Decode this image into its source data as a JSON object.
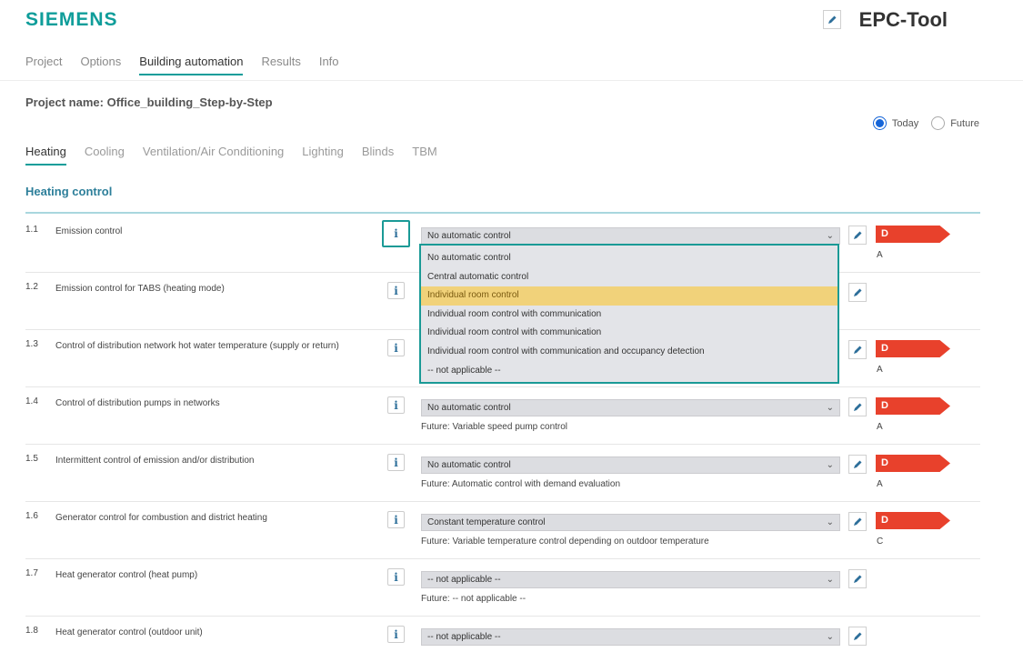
{
  "brand": {
    "logo": "SIEMENS",
    "app_title": "EPC-Tool"
  },
  "main_tabs": [
    {
      "label": "Project"
    },
    {
      "label": "Options"
    },
    {
      "label": "Building automation"
    },
    {
      "label": "Results"
    },
    {
      "label": "Info"
    }
  ],
  "project_name": "Project name: Office_building_Step-by-Step",
  "scenario": {
    "today": "Today",
    "future": "Future",
    "selected": "Today"
  },
  "sub_tabs": [
    {
      "label": "Heating"
    },
    {
      "label": "Cooling"
    },
    {
      "label": "Ventilation/Air Conditioning"
    },
    {
      "label": "Lighting"
    },
    {
      "label": "Blinds"
    },
    {
      "label": "TBM"
    }
  ],
  "section_title": "Heating control",
  "icons": {
    "info": "info-icon",
    "edit": "pencil-icon",
    "chevron": "chevron-down-icon"
  },
  "info_glyph": "i",
  "chevron_glyph": "⌄",
  "rows": [
    {
      "num": "1.1",
      "label": "Emission control",
      "value": "No automatic control",
      "future": "",
      "rating": "D",
      "target": "A"
    },
    {
      "num": "1.2",
      "label": "Emission control for TABS (heating mode)",
      "value": "",
      "future": "",
      "rating": "",
      "target": ""
    },
    {
      "num": "1.3",
      "label": "Control of distribution network hot water temperature (supply or return)",
      "value": "",
      "future": "",
      "rating": "D",
      "target": "A"
    },
    {
      "num": "1.4",
      "label": "Control of distribution pumps in networks",
      "value": "No automatic control",
      "future": "Future: Variable speed pump control",
      "rating": "D",
      "target": "A"
    },
    {
      "num": "1.5",
      "label": "Intermittent control of emission and/or distribution",
      "value": "No automatic control",
      "future": "Future: Automatic control with demand evaluation",
      "rating": "D",
      "target": "A"
    },
    {
      "num": "1.6",
      "label": "Generator control for combustion and district heating",
      "value": "Constant temperature control",
      "future": "Future: Variable temperature control depending on outdoor temperature",
      "rating": "D",
      "target": "C"
    },
    {
      "num": "1.7",
      "label": "Heat generator control (heat pump)",
      "value": "-- not applicable --",
      "future": "Future: -- not applicable --",
      "rating": "",
      "target": ""
    },
    {
      "num": "1.8",
      "label": "Heat generator control (outdoor unit)",
      "value": "-- not applicable --",
      "future": "",
      "rating": "",
      "target": ""
    }
  ],
  "dropdown": {
    "options": [
      "No automatic control",
      "Central automatic control",
      "Individual room control",
      "Individual room control with communication",
      "Individual room control with communication",
      "Individual room control with communication and occupancy detection",
      "-- not applicable --"
    ],
    "highlighted_index": 2
  },
  "colors": {
    "brand": "#0f9d9a",
    "accent": "#1a9a96",
    "rating_d": "#e8412c",
    "highlight": "#f1d27a",
    "section_title": "#2d7f9a",
    "radio": "#1565d8"
  }
}
